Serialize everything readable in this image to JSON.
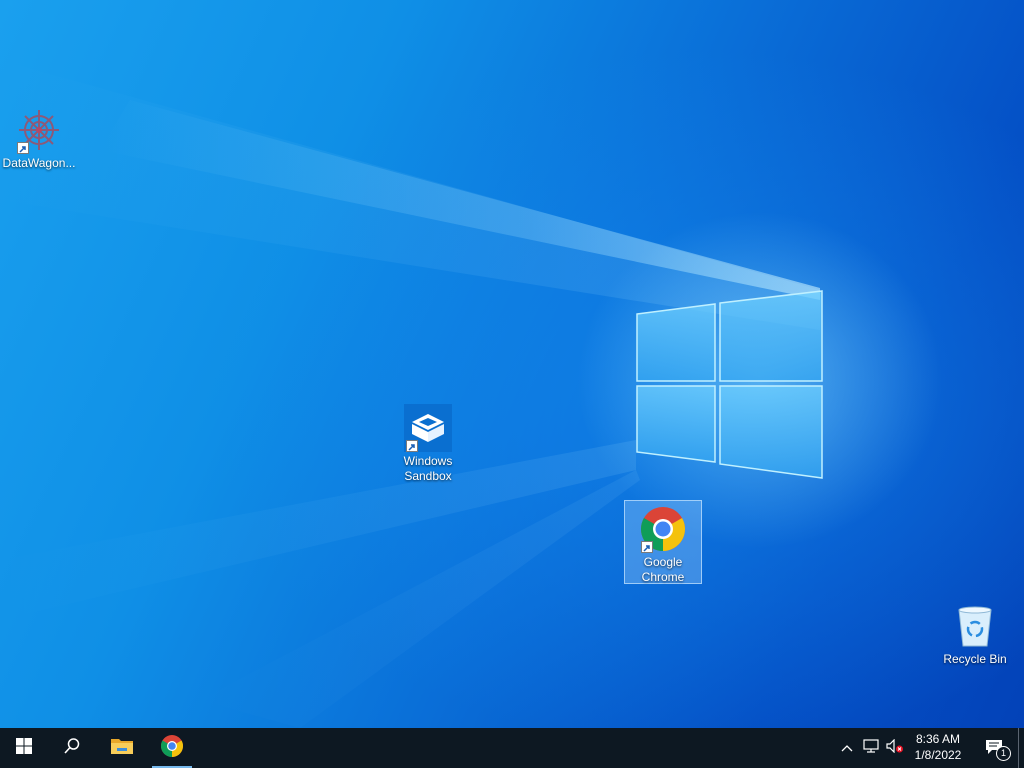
{
  "desktop": {
    "icons": [
      {
        "id": "datawagon",
        "label": "DataWagon..."
      },
      {
        "id": "sandbox",
        "label": "Windows Sandbox"
      },
      {
        "id": "chrome",
        "label": "Google Chrome"
      },
      {
        "id": "recycle",
        "label": "Recycle Bin"
      }
    ]
  },
  "taskbar": {
    "buttons": [
      {
        "name": "start",
        "icon": "windows-logo-icon"
      },
      {
        "name": "search",
        "icon": "search-icon"
      },
      {
        "name": "file-explorer",
        "icon": "folder-icon"
      },
      {
        "name": "chrome",
        "icon": "chrome-icon",
        "active": true
      }
    ],
    "tray": {
      "chevron_icon": "chevron-up-icon",
      "network_icon": "network-icon",
      "volume_icon": "volume-muted-icon",
      "notifications_icon": "notifications-icon",
      "notification_count": "1"
    },
    "clock": {
      "time": "8:36 AM",
      "date": "1/8/2022"
    }
  },
  "colors": {
    "taskbar": "#0d1822",
    "desktop_accent": "#0a6fd8",
    "active_indicator": "#76b9ed"
  }
}
